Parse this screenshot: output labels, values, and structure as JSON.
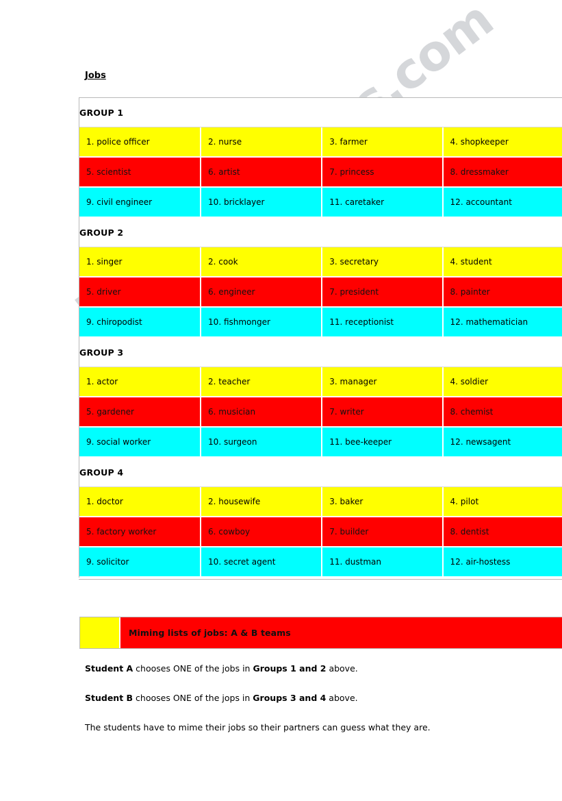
{
  "document": {
    "title": "Jobs",
    "watermark": "ESLprintables.com"
  },
  "colors": {
    "yellow": "#FFFF00",
    "red": "#FF0000",
    "cyan": "#00FFFF",
    "border": "#B9B9B9",
    "text": "#000000"
  },
  "table": {
    "groups": [
      {
        "heading": "GROUP 1",
        "rows": [
          {
            "color": "yellow",
            "cells": [
              "1. police officer",
              "2. nurse",
              "3. farmer",
              "4. shopkeeper"
            ]
          },
          {
            "color": "red",
            "cells": [
              "5. scientist",
              "6. artist",
              "7. princess",
              "8. dressmaker"
            ]
          },
          {
            "color": "cyan",
            "cells": [
              "9. civil engineer",
              "10. bricklayer",
              "11. caretaker",
              "12. accountant"
            ]
          }
        ]
      },
      {
        "heading": "GROUP 2",
        "rows": [
          {
            "color": "yellow",
            "cells": [
              "1. singer",
              "2. cook",
              "3. secretary",
              "4. student"
            ]
          },
          {
            "color": "red",
            "cells": [
              "5. driver",
              "6. engineer",
              "7. president",
              "8. painter"
            ]
          },
          {
            "color": "cyan",
            "cells": [
              "9. chiropodist",
              "10. fishmonger",
              "11. receptionist",
              "12. mathematician"
            ]
          }
        ]
      },
      {
        "heading": "GROUP 3",
        "rows": [
          {
            "color": "yellow",
            "cells": [
              "1. actor",
              "2. teacher",
              "3. manager",
              "4. soldier"
            ]
          },
          {
            "color": "red",
            "cells": [
              "5. gardener",
              "6. musician",
              "7. writer",
              "8. chemist"
            ]
          },
          {
            "color": "cyan",
            "cells": [
              "9. social worker",
              "10. surgeon",
              "11. bee-keeper",
              "12. newsagent"
            ]
          }
        ]
      },
      {
        "heading": "GROUP 4",
        "rows": [
          {
            "color": "yellow",
            "cells": [
              "1. doctor",
              "2. housewife",
              "3. baker",
              "4. pilot"
            ]
          },
          {
            "color": "red",
            "cells": [
              "5. factory worker",
              "6. cowboy",
              "7. builder",
              "8. dentist"
            ]
          },
          {
            "color": "cyan",
            "cells": [
              "9. solicitor",
              "10. secret agent",
              "11. dustman",
              "12. air-hostess"
            ]
          }
        ]
      }
    ]
  },
  "banner": {
    "swatch_color": "#FFFF00",
    "background_color": "#FF0000",
    "label": "Miming lists of jobs: A & B teams"
  },
  "instructions": [
    {
      "segments": [
        {
          "text": "Student A",
          "bold": true
        },
        {
          "text": " chooses ONE of the jobs in ",
          "bold": false
        },
        {
          "text": "Groups 1 and 2",
          "bold": true
        },
        {
          "text": " above.",
          "bold": false
        }
      ]
    },
    {
      "segments": [
        {
          "text": "Student B",
          "bold": true
        },
        {
          "text": " chooses ONE of the jops in ",
          "bold": false
        },
        {
          "text": "Groups 3 and 4",
          "bold": true
        },
        {
          "text": " above.",
          "bold": false
        }
      ]
    },
    {
      "segments": [
        {
          "text": "The students have to mime their jobs so their partners can guess what they are.",
          "bold": false
        }
      ]
    }
  ]
}
